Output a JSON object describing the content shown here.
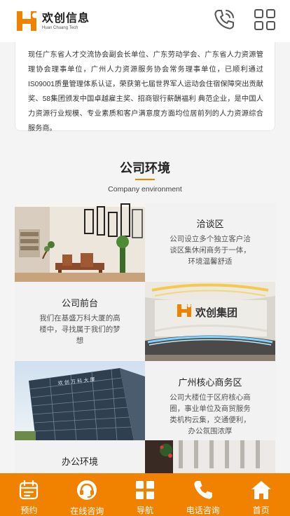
{
  "header": {
    "brand_name": "欢创信息",
    "brand_tagline": "Huan Chuang Tech",
    "brand_color": "#f08200"
  },
  "intro": {
    "text": "现任广东省人才交流协会副会长单位、广东劳动学会、广东省人力资源管理协会理事单位，广州人力资源服务协会常务理事单位，已顺利通过IS09001质量管理体系认证，荣获第七届世界军人运动会住宿保障突出贡献奖、58集团颁发中国卓越雇主奖、招商银行薪酬福利 典范企业，是中国人力资源行业规模、专业素质和客户满意度方面均位居前列的人力资源综合服务商。"
  },
  "section": {
    "title": "公司环境",
    "subtitle": "Company environment"
  },
  "environments": [
    {
      "title": "洽谈区",
      "desc": "公司设立多个独立客户洽谈区集休闲商务于一体，环境温馨舒适"
    },
    {
      "title": "公司前台",
      "desc": "我们在基盛万科大厦的高楼中，寻找属于我们的梦想"
    },
    {
      "title": "广州核心商务区",
      "desc": "公司大楼位于区府核心商圈，事业单位及商贸服务类机构云集，交通便利，办公氛围浓厚"
    },
    {
      "title": "办公环境",
      "desc": ""
    }
  ],
  "reception_wall_text": "欢创集团",
  "footer": {
    "items": [
      {
        "label": "预约",
        "icon": "calendar-icon"
      },
      {
        "label": "在线咨询",
        "icon": "headset-icon"
      },
      {
        "label": "导航",
        "icon": "grid-nav-icon"
      },
      {
        "label": "电话咨询",
        "icon": "phone-icon"
      },
      {
        "label": "首页",
        "icon": "home-icon"
      }
    ]
  }
}
